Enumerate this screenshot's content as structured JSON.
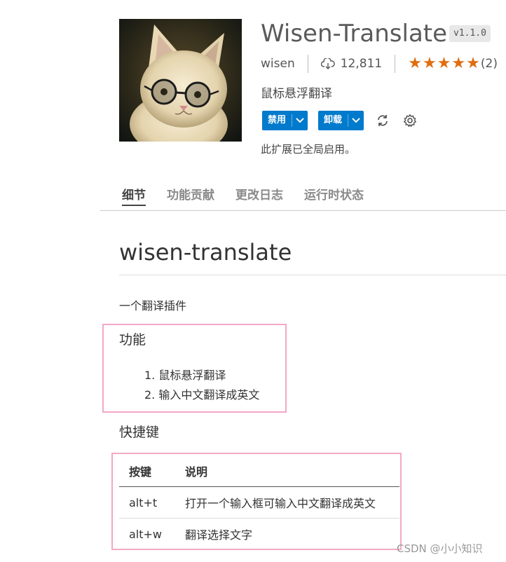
{
  "extension": {
    "title": "Wisen-Translate",
    "version": "v1.1.0",
    "publisher": "wisen",
    "installs": "12,811",
    "rating_stars": 5,
    "rating_count": "(2)",
    "description": "鼠标悬浮翻译",
    "disable_label": "禁用",
    "uninstall_label": "卸载",
    "status_note": "此扩展已全局启用。",
    "accent_color": "#007acc",
    "star_color": "#e06d10"
  },
  "tabs": [
    {
      "label": "细节",
      "active": true
    },
    {
      "label": "功能贡献",
      "active": false
    },
    {
      "label": "更改日志",
      "active": false
    },
    {
      "label": "运行时状态",
      "active": false
    }
  ],
  "readme": {
    "title": "wisen-translate",
    "intro": "一个翻译插件",
    "features_heading": "功能",
    "features": [
      "鼠标悬浮翻译",
      "输入中文翻译成英文"
    ],
    "shortcuts_heading": "快捷键",
    "shortcuts_table": {
      "headers": [
        "按键",
        "说明"
      ],
      "rows": [
        [
          "alt+t",
          "打开一个输入框可输入中文翻译成英文"
        ],
        [
          "alt+w",
          "翻译选择文字"
        ]
      ]
    },
    "highlight_color": "#f4a8c6"
  },
  "watermark": "CSDN @小小知识"
}
